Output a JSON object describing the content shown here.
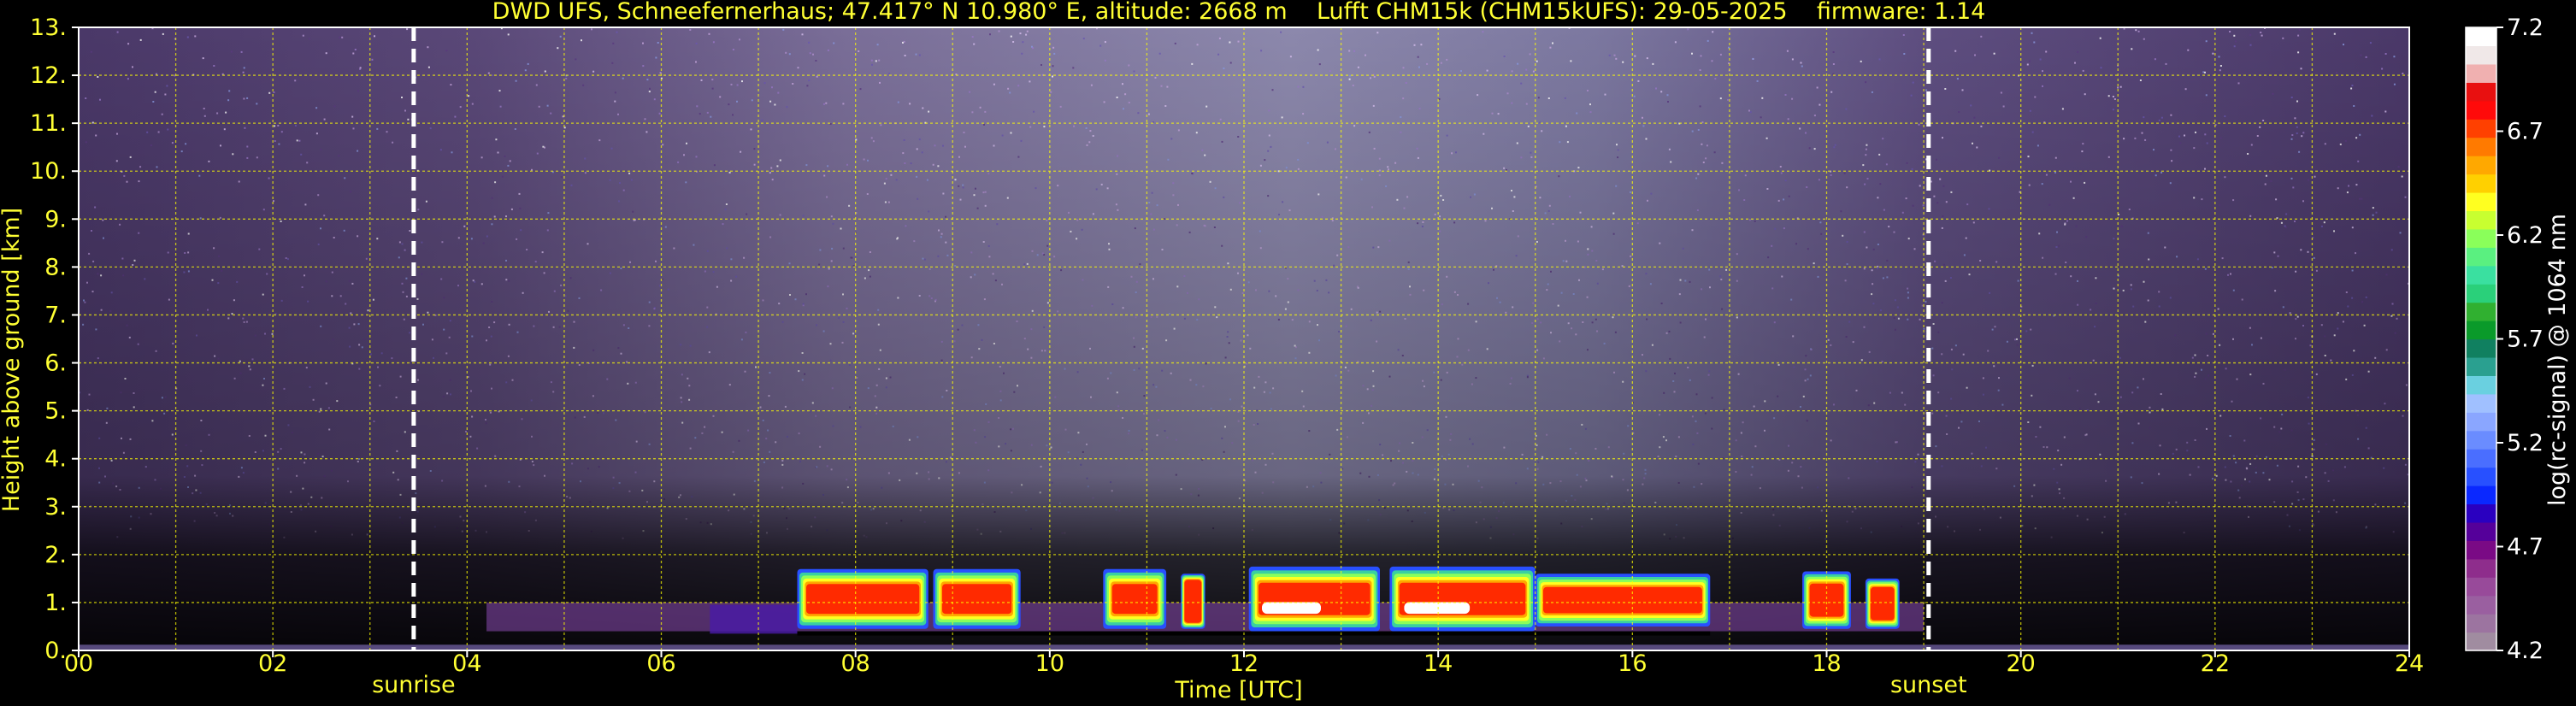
{
  "chart_data": {
    "type": "heatmap",
    "title": "DWD UFS, Schneefernerhaus; 47.417° N 10.980° E, altitude: 2668 m    Lufft CHM15k (CHM15kUFS): 29-05-2025    firmware: 1.14",
    "xlabel": "Time [UTC]",
    "ylabel": "Height above ground [km]",
    "colorbar_label": "log(rc-signal) @ 1064 nm",
    "xlim": [
      0,
      24
    ],
    "ylim": [
      0,
      13
    ],
    "x_ticks": [
      "00",
      "02",
      "04",
      "06",
      "08",
      "10",
      "12",
      "14",
      "16",
      "18",
      "20",
      "22",
      "24"
    ],
    "y_ticks": [
      "0.",
      "1.",
      "2.",
      "3.",
      "4.",
      "5.",
      "6.",
      "7.",
      "8.",
      "9.",
      "10.",
      "11.",
      "12.",
      "13."
    ],
    "colorbar_ticks": [
      "4.2",
      "4.7",
      "5.2",
      "5.7",
      "6.2",
      "6.7",
      "7.2"
    ],
    "colorbar_range": [
      4.2,
      7.2
    ],
    "grid": true,
    "grid_color": "#ffff00",
    "text_color": "#ffff33",
    "background": "#000000",
    "events": [
      {
        "label": "sunrise",
        "time": 3.45
      },
      {
        "label": "sunset",
        "time": 19.05
      }
    ],
    "colorbar_colors": [
      "#a08ca0",
      "#9c74a0",
      "#9a5fa0",
      "#984a9a",
      "#8e2d8c",
      "#7a0a85",
      "#55009a",
      "#2a00c0",
      "#0a28ff",
      "#2850ff",
      "#4a6eff",
      "#6a8cff",
      "#8aa6ff",
      "#a0c0ff",
      "#6ad0e0",
      "#2aa090",
      "#108060",
      "#0a9a2a",
      "#30b030",
      "#2ad07a",
      "#3ae0a0",
      "#5af080",
      "#8aff5a",
      "#c8ff30",
      "#ffff20",
      "#ffd000",
      "#ffa800",
      "#ff7a00",
      "#ff4000",
      "#ff0a0a",
      "#e81010",
      "#f0b0b0",
      "#f0e8e8",
      "#ffffff"
    ],
    "cloud_segments": [
      {
        "start": 7.4,
        "end": 8.75,
        "base": 0.45,
        "top": 1.7
      },
      {
        "start": 8.8,
        "end": 9.7,
        "base": 0.45,
        "top": 1.7
      },
      {
        "start": 10.55,
        "end": 11.2,
        "base": 0.45,
        "top": 1.7
      },
      {
        "start": 11.35,
        "end": 11.6,
        "base": 0.45,
        "top": 1.6
      },
      {
        "start": 12.05,
        "end": 13.4,
        "base": 0.4,
        "top": 1.75
      },
      {
        "start": 13.5,
        "end": 15.0,
        "base": 0.4,
        "top": 1.75
      },
      {
        "start": 15.0,
        "end": 16.8,
        "base": 0.5,
        "top": 1.6
      },
      {
        "start": 17.75,
        "end": 18.25,
        "base": 0.45,
        "top": 1.65
      },
      {
        "start": 18.4,
        "end": 18.75,
        "base": 0.45,
        "top": 1.5
      }
    ],
    "aerosol_layer": {
      "start": 4.2,
      "end": 19.0,
      "base": 0.4,
      "top": 1.0
    }
  }
}
